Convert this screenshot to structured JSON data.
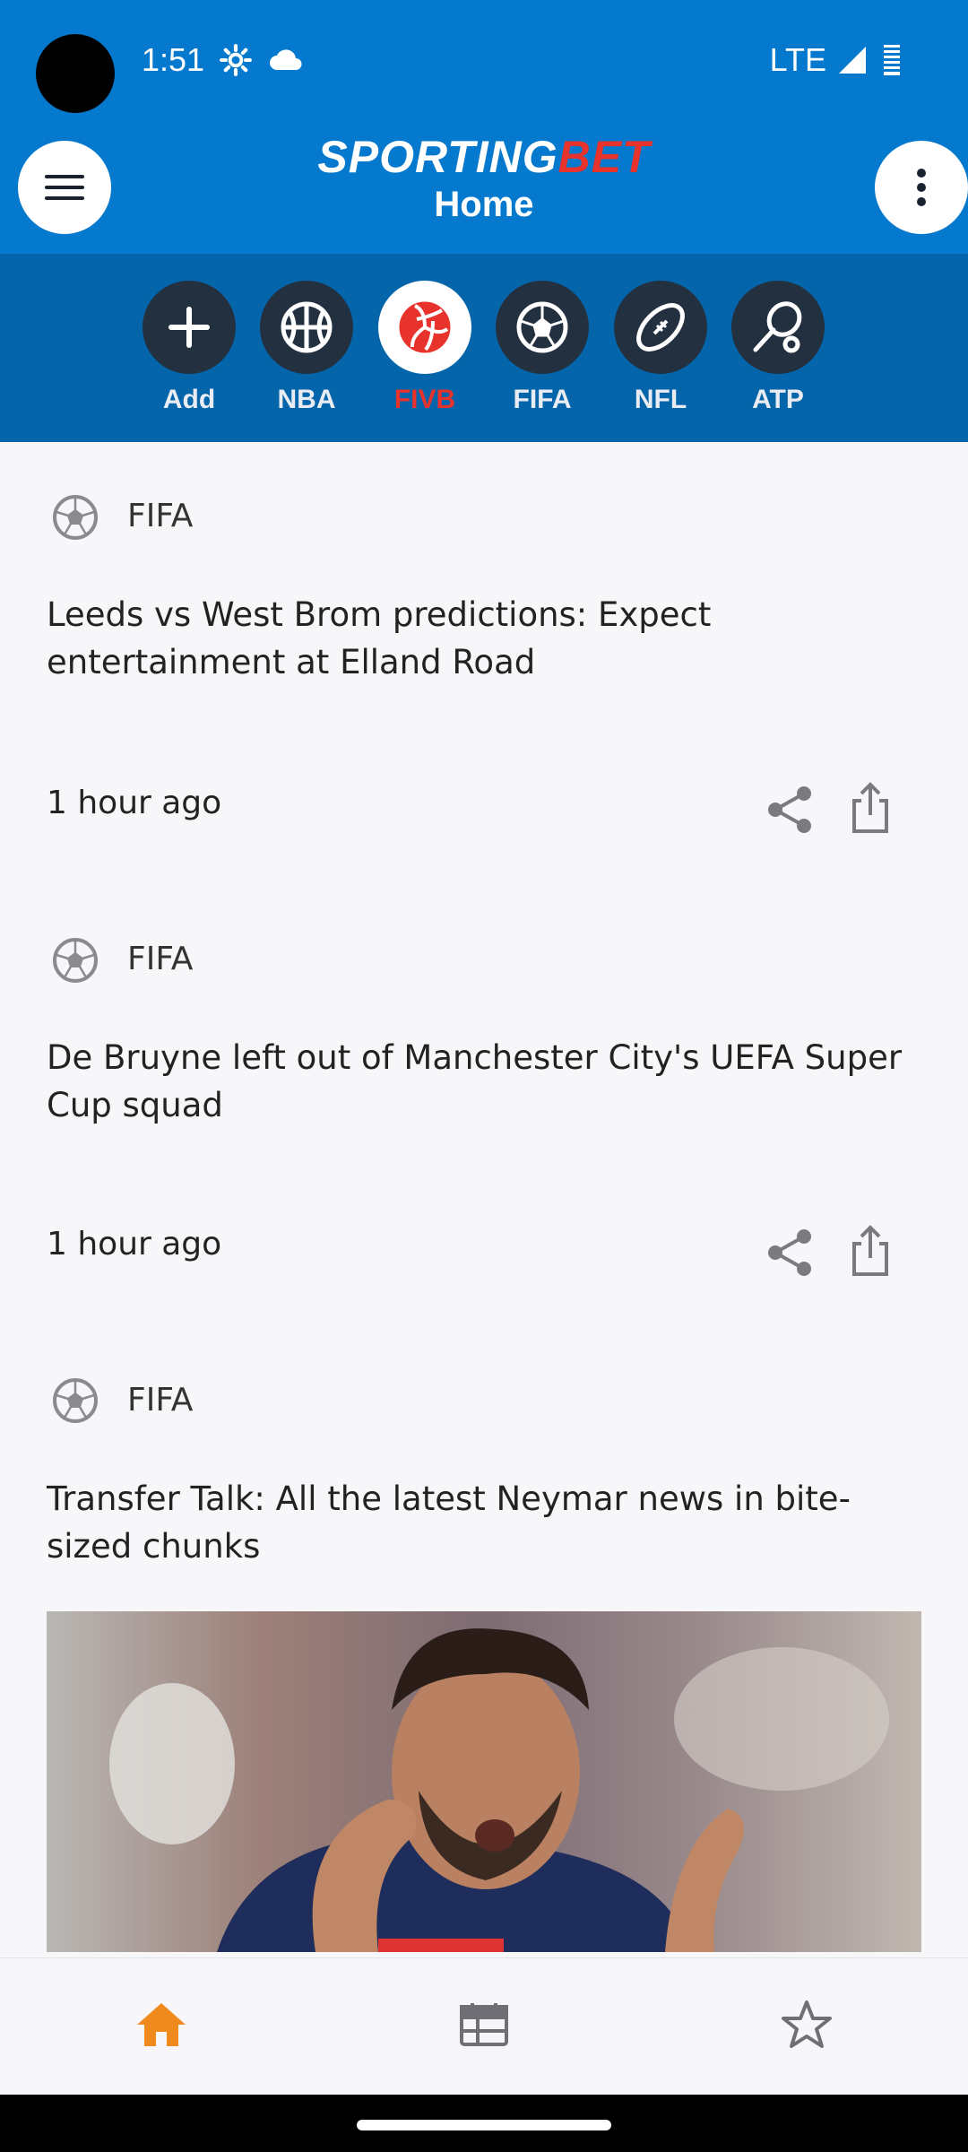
{
  "status": {
    "time": "1:51",
    "network": "LTE"
  },
  "header": {
    "brand_main": "SPORTING",
    "brand_accent": "BET",
    "title": "Home"
  },
  "sports": [
    {
      "label": "Add",
      "icon": "plus-icon",
      "active": false
    },
    {
      "label": "NBA",
      "icon": "basketball-icon",
      "active": false
    },
    {
      "label": "FIVB",
      "icon": "volleyball-icon",
      "active": true
    },
    {
      "label": "FIFA",
      "icon": "soccer-ball-icon",
      "active": false
    },
    {
      "label": "NFL",
      "icon": "football-icon",
      "active": false
    },
    {
      "label": "ATP",
      "icon": "tennis-racket-icon",
      "active": false
    }
  ],
  "articles": [
    {
      "category": "FIFA",
      "headline": "Leeds vs West Brom predictions: Expect entertainment at Elland Road",
      "time": "1 hour ago"
    },
    {
      "category": "FIFA",
      "headline": "De Bruyne left out of Manchester City's UEFA Super Cup squad",
      "time": "1 hour ago"
    },
    {
      "category": "FIFA",
      "headline": "Transfer Talk: All the latest Neymar news in bite-sized chunks"
    }
  ],
  "bottom_nav": [
    {
      "name": "home",
      "icon": "home-icon",
      "active": true
    },
    {
      "name": "schedule",
      "icon": "calendar-icon",
      "active": false
    },
    {
      "name": "favorites",
      "icon": "star-icon",
      "active": false
    }
  ],
  "colors": {
    "header_bg": "#0579cd",
    "sports_bg": "#0565aa",
    "accent": "#e8322c",
    "nav_active": "#f08a1c"
  }
}
